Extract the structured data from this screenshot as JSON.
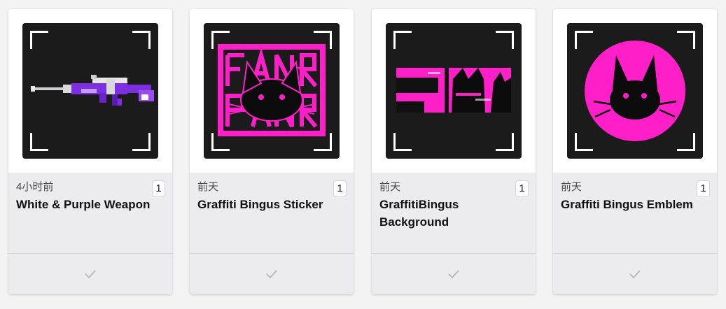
{
  "cards": [
    {
      "time": "4小时前",
      "title": "White & Purple Weapon",
      "count": "1",
      "thumbnail": "weapon-icon"
    },
    {
      "time": "前天",
      "title": "Graffiti Bingus Sticker",
      "count": "1",
      "thumbnail": "sticker-icon"
    },
    {
      "time": "前天",
      "title": "GraffitiBingus Background",
      "count": "1",
      "thumbnail": "background-icon"
    },
    {
      "time": "前天",
      "title": "Graffiti Bingus Emblem",
      "count": "1",
      "thumbnail": "emblem-icon"
    }
  ],
  "colors": {
    "accent": "#ff1fc8",
    "thumb_bg": "#1b1b1b",
    "weapon": "#7b2fe0"
  },
  "footer_icon": "checkmark-icon"
}
